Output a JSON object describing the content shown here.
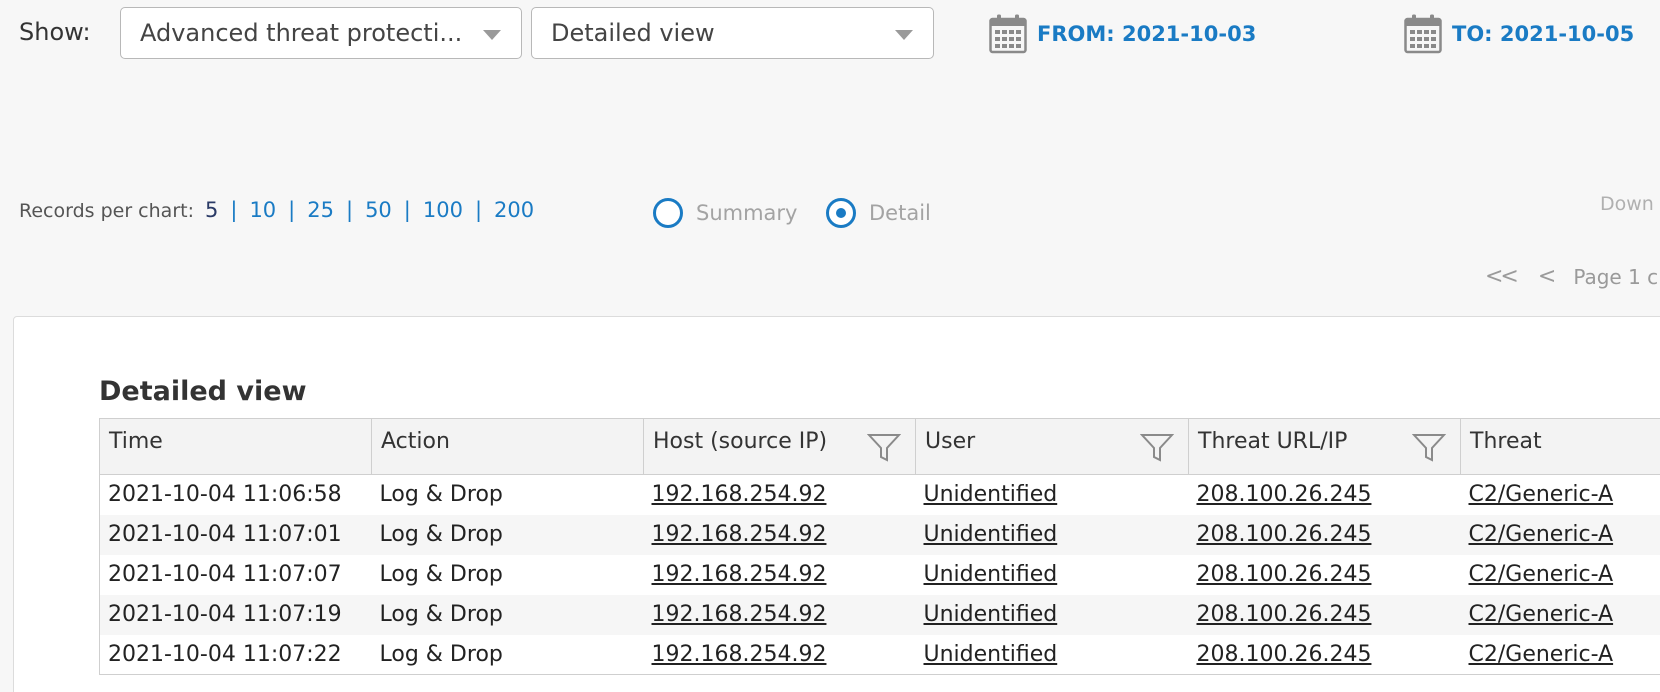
{
  "filters": {
    "show_label": "Show:",
    "report_select": "Advanced threat protecti...",
    "view_select": "Detailed view",
    "from_date": "FROM: 2021-10-03",
    "to_date": "TO: 2021-10-05"
  },
  "records": {
    "label": "Records per chart:",
    "options": [
      "5",
      "10",
      "25",
      "50",
      "100",
      "200"
    ],
    "current": "5"
  },
  "mode": {
    "summary_label": "Summary",
    "detail_label": "Detail",
    "selected": "Detail"
  },
  "download_label": "Down",
  "pager": {
    "first": "<<",
    "prev": "<",
    "page_text": "Page 1  c"
  },
  "table": {
    "title": "Detailed view",
    "columns": [
      "Time",
      "Action",
      "Host (source IP)",
      "User",
      "Threat URL/IP",
      "Threat"
    ],
    "rows": [
      [
        "2021-10-04 11:06:58",
        "Log & Drop",
        "192.168.254.92",
        "Unidentified",
        "208.100.26.245",
        "C2/Generic-A"
      ],
      [
        "2021-10-04 11:07:01",
        "Log & Drop",
        "192.168.254.92",
        "Unidentified",
        "208.100.26.245",
        "C2/Generic-A"
      ],
      [
        "2021-10-04 11:07:07",
        "Log & Drop",
        "192.168.254.92",
        "Unidentified",
        "208.100.26.245",
        "C2/Generic-A"
      ],
      [
        "2021-10-04 11:07:19",
        "Log & Drop",
        "192.168.254.92",
        "Unidentified",
        "208.100.26.245",
        "C2/Generic-A"
      ],
      [
        "2021-10-04 11:07:22",
        "Log & Drop",
        "192.168.254.92",
        "Unidentified",
        "208.100.26.245",
        "C2/Generic-A"
      ]
    ]
  },
  "colors": {
    "accent": "#1a7bc4",
    "background": "#f7f7f7"
  },
  "icons": {
    "calendar": "calendar-icon",
    "filter": "filter-funnel-icon",
    "dropdown": "chevron-down-icon"
  }
}
